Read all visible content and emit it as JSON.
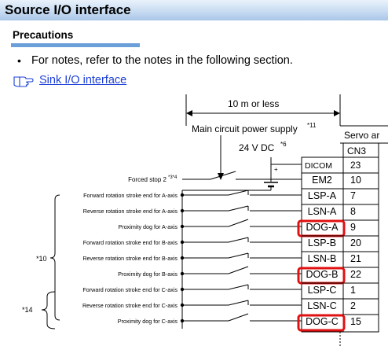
{
  "header": {
    "title": "Source I/O interface"
  },
  "precautions": {
    "heading": "Precautions",
    "note": "For notes, refer to the notes in the following section.",
    "link_label": "Sink I/O interface"
  },
  "diagram": {
    "distance_label": "10 m or less",
    "power_label": "Main circuit power supply",
    "power_note": "*11",
    "voltage_label": "24 V DC",
    "voltage_note": "*6",
    "servo_label": "Servo ar",
    "connector_label": "CN3",
    "group_note_a": "*10",
    "group_note_c": "*14",
    "rows": [
      {
        "desc": "Forced stop 2",
        "note": "*3*4",
        "signal": "EM2",
        "pin": "10",
        "highlight": false
      },
      {
        "desc": "Forward rotation stroke end for A-axis",
        "note": "",
        "signal": "LSP-A",
        "pin": "7",
        "highlight": false
      },
      {
        "desc": "Reverse rotation stroke end for A-axis",
        "note": "",
        "signal": "LSN-A",
        "pin": "8",
        "highlight": false
      },
      {
        "desc": "Proximity dog for A-axis",
        "note": "",
        "signal": "DOG-A",
        "pin": "9",
        "highlight": true
      },
      {
        "desc": "Forward rotation stroke end for B-axis",
        "note": "",
        "signal": "LSP-B",
        "pin": "20",
        "highlight": false
      },
      {
        "desc": "Reverse rotation stroke end for B-axis",
        "note": "",
        "signal": "LSN-B",
        "pin": "21",
        "highlight": false
      },
      {
        "desc": "Proximity dog for B-axis",
        "note": "",
        "signal": "DOG-B",
        "pin": "22",
        "highlight": true
      },
      {
        "desc": "Forward rotation stroke end for C-axis",
        "note": "",
        "signal": "LSP-C",
        "pin": "1",
        "highlight": false
      },
      {
        "desc": "Reverse rotation stroke end for C-axis",
        "note": "",
        "signal": "LSN-C",
        "pin": "2",
        "highlight": false
      },
      {
        "desc": "Proximity dog for C-axis",
        "note": "",
        "signal": "DOG-C",
        "pin": "15",
        "highlight": true
      }
    ],
    "dicom": {
      "signal": "DICOM",
      "pin": "23"
    },
    "colors": {
      "highlight": "#e01010",
      "link": "#1c3fd6",
      "accent": "#6a9fd8"
    }
  }
}
